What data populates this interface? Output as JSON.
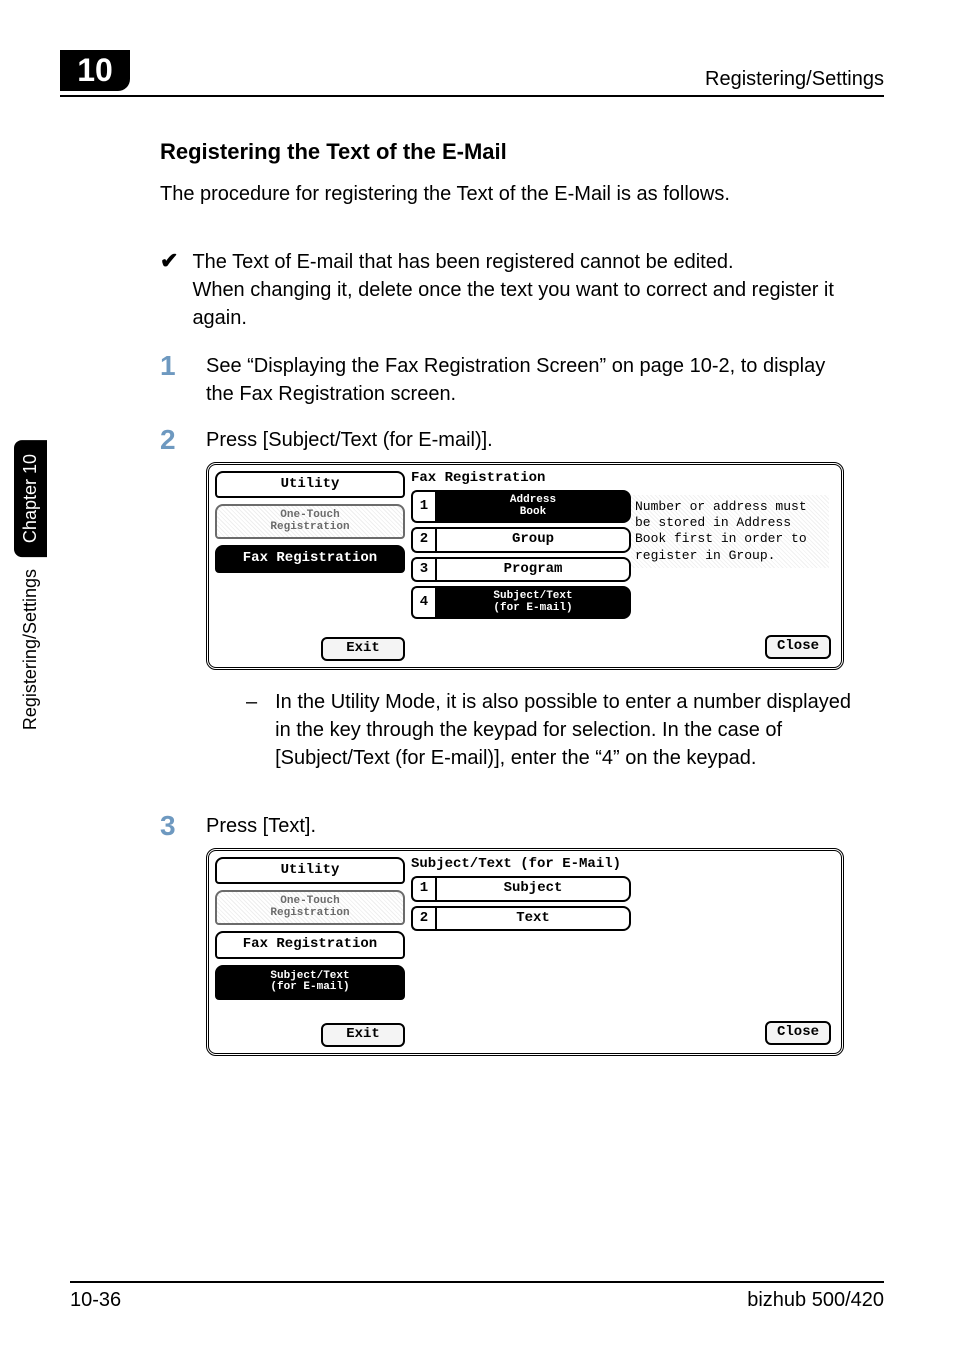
{
  "header": {
    "chapter_number": "10",
    "running_title": "Registering/Settings"
  },
  "side_tab": {
    "black_label": "Chapter 10",
    "plain_label": "Registering/Settings"
  },
  "content": {
    "section_heading": "Registering the Text of the E-Mail",
    "intro": "The procedure for registering the Text of the E-Mail is as follows.",
    "check_note_line1": "The Text of E-mail that has been registered cannot be edited.",
    "check_note_line2": "When changing it, delete once the text you want to correct and register it again.",
    "step1": "See “Displaying the Fax Registration Screen” on page 10-2, to display the Fax Registration screen.",
    "step2": "Press [Subject/Text (for E-mail)].",
    "step2_subnote": "In the Utility Mode, it is also possible to enter a number displayed in the key through the keypad for selection. In the case of [Subject/Text (for E-mail)], enter the “4” on the keypad.",
    "step3": "Press [Text].",
    "step_numbers": {
      "s1": "1",
      "s2": "2",
      "s3": "3"
    },
    "dash": "–",
    "checkmark": "✔"
  },
  "panel1": {
    "left_utility": "Utility",
    "left_onetouch_l1": "One-Touch",
    "left_onetouch_l2": "Registration",
    "left_faxreg": "Fax Registration",
    "left_exit": "Exit",
    "title": "Fax Registration",
    "rows": {
      "r1_idx": "1",
      "r1_label_l1": "Address",
      "r1_label_l2": "Book",
      "r2_idx": "2",
      "r2_label": "Group",
      "r3_idx": "3",
      "r3_label": "Program",
      "r4_idx": "4",
      "r4_label_l1": "Subject/Text",
      "r4_label_l2": "(for E-mail)"
    },
    "info_text": "Number or address must be stored in Address Book first in order to register in Group.",
    "close": "Close"
  },
  "panel2": {
    "left_utility": "Utility",
    "left_onetouch_l1": "One-Touch",
    "left_onetouch_l2": "Registration",
    "left_faxreg": "Fax Registration",
    "left_subjecttext_l1": "Subject/Text",
    "left_subjecttext_l2": "(for E-mail)",
    "left_exit": "Exit",
    "title": "Subject/Text (for E-Mail)",
    "rows": {
      "r1_idx": "1",
      "r1_label": "Subject",
      "r2_idx": "2",
      "r2_label": "Text"
    },
    "close": "Close"
  },
  "footer": {
    "page_number": "10-36",
    "model": "bizhub 500/420"
  }
}
